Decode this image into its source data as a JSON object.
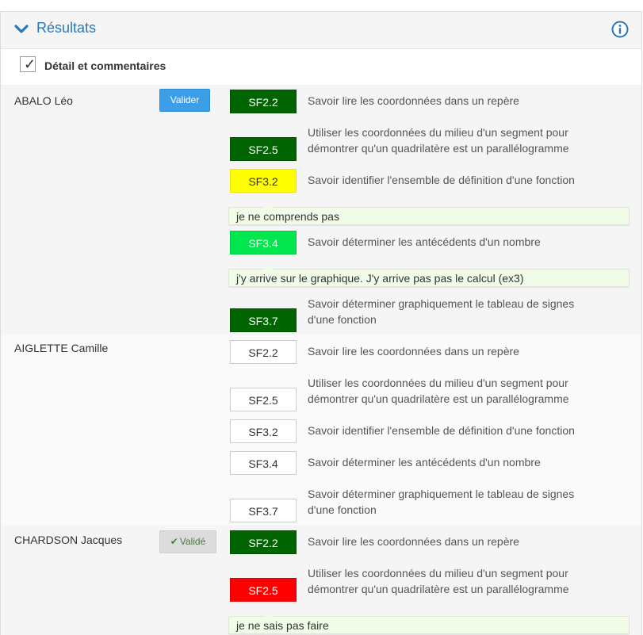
{
  "header": {
    "title": "Résultats"
  },
  "detail": {
    "label": "Détail et commentaires",
    "checked": true
  },
  "students": [
    {
      "name": "ABALO Léo",
      "action": "Valider",
      "skills": [
        {
          "code": "SF2.2",
          "label": "Savoir lire les coordonnées dans un repère",
          "color": "#006400"
        },
        {
          "code": "SF2.5",
          "label_line1": "Utiliser les coordonnées du milieu d'un segment pour",
          "label_line2": "démontrer qu'un quadrilatère est un parallélogramme",
          "color": "#006400"
        },
        {
          "code": "SF3.2",
          "label": "Savoir identifier l'ensemble de définition d'une fonction",
          "color": "#ffff00",
          "comment": "je ne comprends pas"
        },
        {
          "code": "SF3.4",
          "label": "Savoir déterminer les antécédents d'un nombre",
          "color": "#00e64c",
          "comment": "j'y arrive sur le graphique. J'y arrive pas pas le calcul (ex3)"
        },
        {
          "code": "SF3.7",
          "label_line1": "Savoir déterminer graphiquement le tableau de signes",
          "label_line2": "d'une fonction",
          "color": "#006400"
        }
      ]
    },
    {
      "name": "AIGLETTE Camille",
      "skills": [
        {
          "code": "SF2.2",
          "label": "Savoir lire les coordonnées dans un repère"
        },
        {
          "code": "SF2.5",
          "label_line1": "Utiliser les coordonnées du milieu d'un segment pour",
          "label_line2": "démontrer qu'un quadrilatère est un parallélogramme"
        },
        {
          "code": "SF3.2",
          "label": "Savoir identifier l'ensemble de définition d'une fonction"
        },
        {
          "code": "SF3.4",
          "label": "Savoir déterminer les antécédents d'un nombre"
        },
        {
          "code": "SF3.7",
          "label_line1": "Savoir déterminer graphiquement le tableau de signes",
          "label_line2": "d'une fonction"
        }
      ]
    },
    {
      "name": "CHARDSON Jacques",
      "action": "Validé",
      "skills": [
        {
          "code": "SF2.2",
          "label": "Savoir lire les coordonnées dans un repère",
          "color": "#006400"
        },
        {
          "code": "SF2.5",
          "label_line1": "Utiliser les coordonnées du milieu d'un segment pour",
          "label_line2": "démontrer qu'un quadrilatère est un parallélogramme",
          "color": "#ff0000",
          "comment": "je ne sais pas faire"
        }
      ]
    }
  ]
}
